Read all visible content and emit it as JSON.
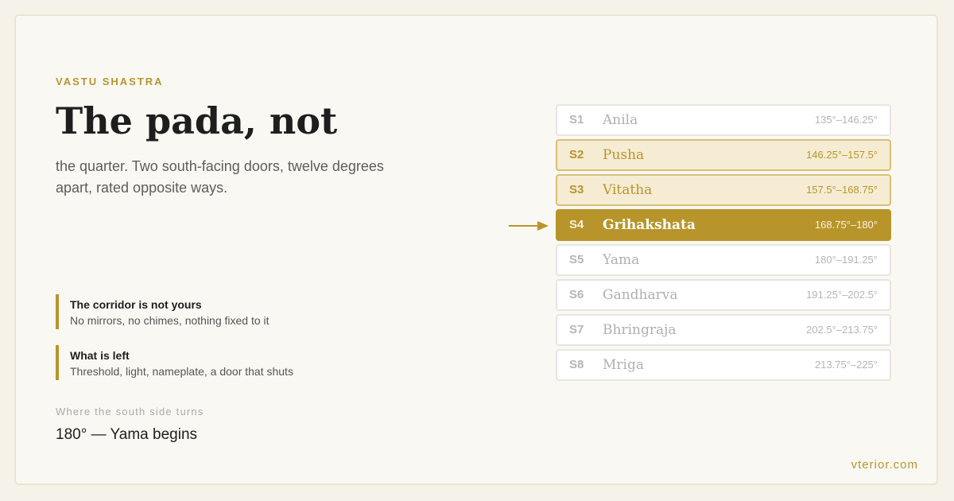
{
  "header": {
    "eyebrow": "VASTU SHASTRA",
    "title": "The pada, not",
    "subtitle": "the quarter. Two south-facing doors, twelve degrees apart, rated opposite ways."
  },
  "notes": [
    {
      "title": "The corridor is not yours",
      "body": "No mirrors, no chimes, nothing fixed to it"
    },
    {
      "title": "What is left",
      "body": "Threshold, light, nameplate, a door that shuts"
    }
  ],
  "turn": {
    "label": "Where the south side turns",
    "value": "180° — Yama begins"
  },
  "brand": "vterior.com",
  "colors": {
    "accent": "#b8952b",
    "accent_soft_bg": "#f6ecd4",
    "background": "#faf8f3"
  },
  "pointer_icon": "right-arrow-icon",
  "padas": [
    {
      "code": "S1",
      "name": "Anila",
      "range": "135°–146.25°",
      "state": "muted"
    },
    {
      "code": "S2",
      "name": "Pusha",
      "range": "146.25°–157.5°",
      "state": "highlighted"
    },
    {
      "code": "S3",
      "name": "Vitatha",
      "range": "157.5°–168.75°",
      "state": "highlighted"
    },
    {
      "code": "S4",
      "name": "Grihakshata",
      "range": "168.75°–180°",
      "state": "active"
    },
    {
      "code": "S5",
      "name": "Yama",
      "range": "180°–191.25°",
      "state": "muted"
    },
    {
      "code": "S6",
      "name": "Gandharva",
      "range": "191.25°–202.5°",
      "state": "muted"
    },
    {
      "code": "S7",
      "name": "Bhringraja",
      "range": "202.5°–213.75°",
      "state": "muted"
    },
    {
      "code": "S8",
      "name": "Mriga",
      "range": "213.75°–225°",
      "state": "muted"
    }
  ]
}
